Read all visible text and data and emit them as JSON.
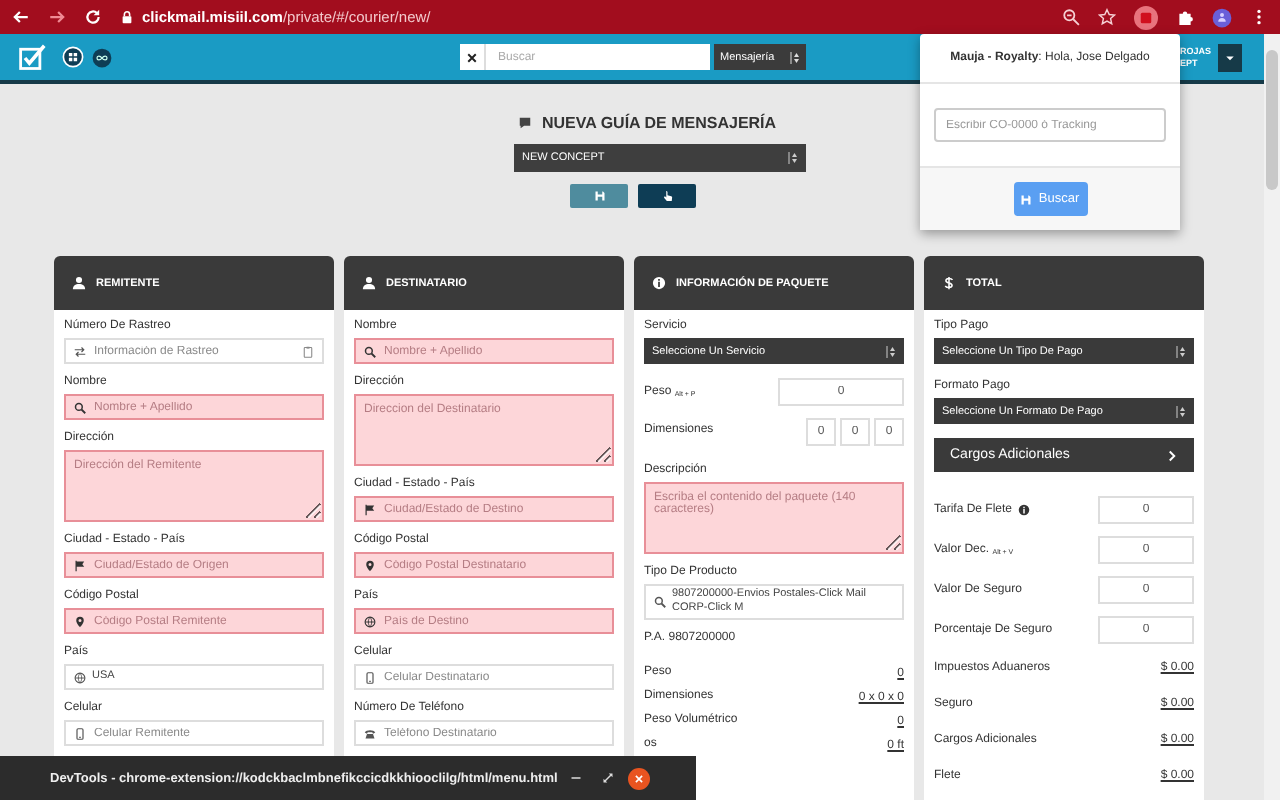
{
  "browser": {
    "url": "**clickmail.misiil.com**/private/#/courier/new/"
  },
  "header": {
    "search_placeholder": "Buscar",
    "module_select": "Mensajería",
    "user_lines": [
      "ROJAS",
      "EPT"
    ]
  },
  "guide": {
    "title": "NUEVA GUÍA DE MENSAJERÍA",
    "company_select": "NEW CONCEPT"
  },
  "cards": [
    {
      "title": "REMITENTE",
      "fields": [
        {
          "kind": "input",
          "label": "Número De Rastreo",
          "placeholder": "Información de Rastreo",
          "invalid": false
        },
        {
          "kind": "input",
          "label": "Nombre",
          "placeholder": "Nombre + Apellido",
          "invalid": true
        },
        {
          "kind": "textarea",
          "label": "Dirección",
          "placeholder": "Dirección del Remitente",
          "invalid": true
        },
        {
          "kind": "input",
          "label": "Ciudad - Estado - País",
          "placeholder": "Ciudad/Estado de Origen",
          "invalid": true
        },
        {
          "kind": "input",
          "label": "Código Postal",
          "placeholder": "Código Postal Remitente",
          "invalid": true
        },
        {
          "kind": "input",
          "label": "País",
          "value": "USA",
          "invalid": false
        },
        {
          "kind": "input",
          "label": "Celular",
          "placeholder": "Celular Remitente",
          "invalid": false
        }
      ]
    },
    {
      "title": "DESTINATARIO",
      "fields": [
        {
          "kind": "input",
          "label": "Nombre",
          "placeholder": "Nombre + Apellido",
          "invalid": true
        },
        {
          "kind": "textarea",
          "label": "Dirección",
          "placeholder": "Direccion del Destinatario",
          "invalid": true
        },
        {
          "kind": "input",
          "label": "Ciudad - Estado - País",
          "placeholder": "Ciudad/Estado de Destino",
          "invalid": true
        },
        {
          "kind": "input",
          "label": "Código Postal",
          "placeholder": "Código Postal Destinatario",
          "invalid": true
        },
        {
          "kind": "input",
          "label": "País",
          "placeholder": "País de Destino",
          "invalid": true
        },
        {
          "kind": "input",
          "label": "Celular",
          "placeholder": "Celular Destinatario",
          "invalid": false
        },
        {
          "kind": "input",
          "label": "Número De Teléfono",
          "placeholder": "Teléfono Destinatario",
          "invalid": false
        }
      ]
    },
    {
      "title": "INFORMACIÓN DE PAQUETE",
      "fields": [
        {
          "kind": "select",
          "label": "Servicio",
          "value": "Seleccione Un Servicio"
        },
        {
          "kind": "inline",
          "label": "Peso $_{Alt + P}$",
          "value": "0",
          "info_icon": false
        },
        {
          "kind": "dims",
          "label": "Dimensiones",
          "values": [
            "0",
            "0",
            "0"
          ]
        },
        {
          "kind": "textarea",
          "label": "Descripción",
          "placeholder": "Escriba el contenido del paquete (140 caracteres)",
          "invalid": true
        },
        {
          "kind": "input",
          "label": "Tipo De Producto",
          "value": "9807200000-Envios Postales-Click Mail CORP-Click M",
          "invalid": false
        },
        {
          "kind": "info",
          "text": "P.A. 9807200000"
        },
        {
          "kind": "readout",
          "label": "Peso",
          "value": "0"
        },
        {
          "kind": "readout",
          "label": "Dimensiones",
          "value": "0 x 0 x 0"
        },
        {
          "kind": "readout",
          "label": "Peso Volumétrico",
          "value": "0"
        },
        {
          "kind": "readout",
          "label": "os",
          "value": "0 ft"
        }
      ]
    },
    {
      "title": "TOTAL",
      "fields": [
        {
          "kind": "select",
          "label": "Tipo Pago",
          "value": "Seleccione Un Tipo De Pago"
        },
        {
          "kind": "select",
          "label": "Formato Pago",
          "value": "Seleccione Un Formato De Pago"
        },
        {
          "kind": "button",
          "label": "Cargos Adicionales"
        },
        {
          "kind": "inline",
          "label": "Tarifa De Flete",
          "value": "0",
          "info_icon": true
        },
        {
          "kind": "inline",
          "label": "Valor Dec. $_{Alt + V}$",
          "value": "0",
          "info_icon": false
        },
        {
          "kind": "inline",
          "label": "Valor De Seguro",
          "value": "0",
          "info_icon": false
        },
        {
          "kind": "inline",
          "label": "Porcentaje De Seguro",
          "value": "0",
          "info_icon": false
        },
        {
          "kind": "readout",
          "label": "Impuestos Aduaneros",
          "value": "$ 0.00"
        },
        {
          "kind": "readout",
          "label": "Seguro",
          "value": "$ 0.00"
        },
        {
          "kind": "readout",
          "label": "Cargos Adicionales",
          "value": "$ 0.00"
        },
        {
          "kind": "readout",
          "label": "Flete",
          "value": "$ 0.00"
        }
      ]
    }
  ],
  "popup": {
    "greeting": "**Mauja - Royalty**: Hola, Jose Delgado",
    "tracking_placeholder": "Escribir CO-0000 ó Tracking",
    "button": "Buscar"
  },
  "devtools": {
    "title": "DevTools - chrome-extension://kodckbaclmbnefikccicdkkhiooclilg/html/menu.html"
  }
}
